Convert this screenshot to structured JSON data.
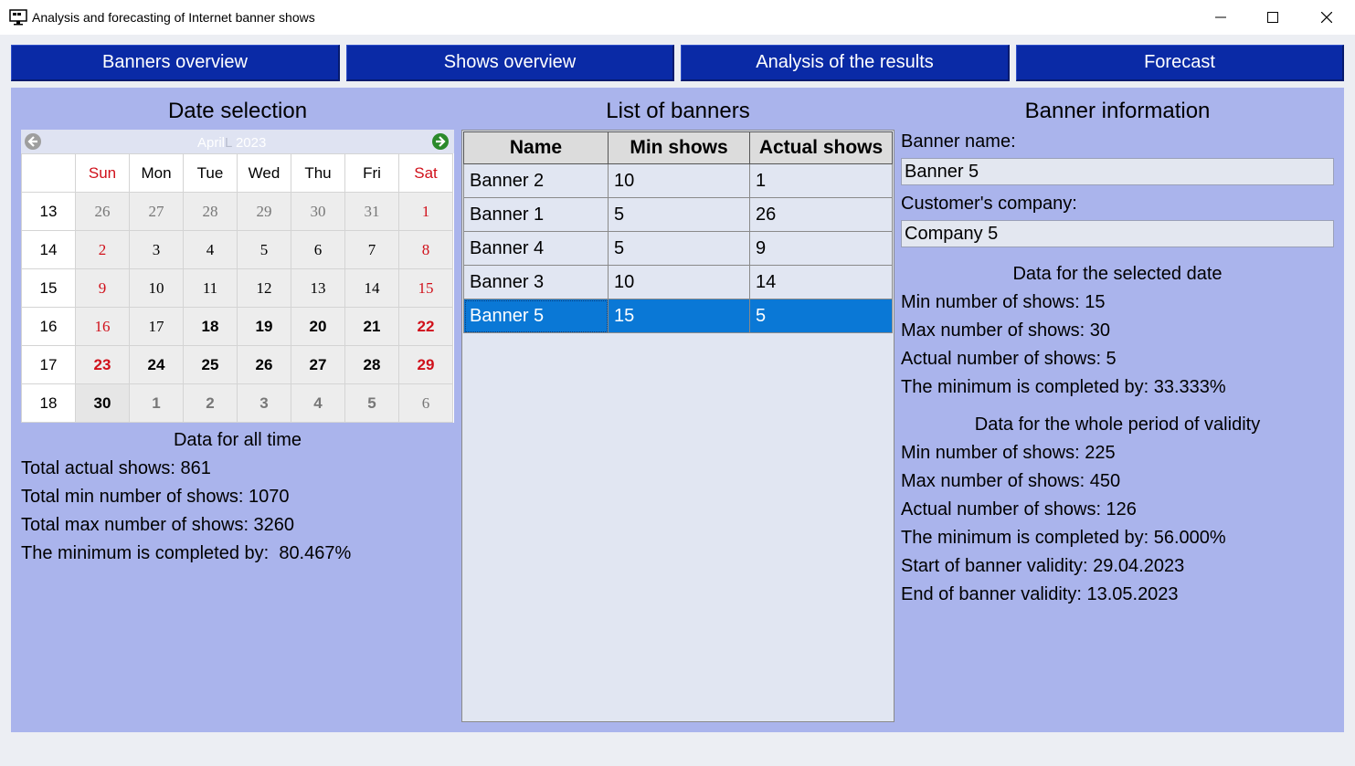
{
  "window": {
    "title": "Analysis and forecasting of Internet banner shows"
  },
  "tabs": [
    {
      "label": "Banners overview"
    },
    {
      "label": "Shows overview"
    },
    {
      "label": "Analysis of the results"
    },
    {
      "label": "Forecast"
    }
  ],
  "date_selection": {
    "title": "Date selection",
    "calendar": {
      "month": "April",
      "year": "2023",
      "day_names": [
        "Sun",
        "Mon",
        "Tue",
        "Wed",
        "Thu",
        "Fri",
        "Sat"
      ],
      "weeks": [
        {
          "week": "13",
          "days": [
            "26",
            "27",
            "28",
            "29",
            "30",
            "31",
            "1"
          ]
        },
        {
          "week": "14",
          "days": [
            "2",
            "3",
            "4",
            "5",
            "6",
            "7",
            "8"
          ]
        },
        {
          "week": "15",
          "days": [
            "9",
            "10",
            "11",
            "12",
            "13",
            "14",
            "15"
          ]
        },
        {
          "week": "16",
          "days": [
            "16",
            "17",
            "18",
            "19",
            "20",
            "21",
            "22"
          ]
        },
        {
          "week": "17",
          "days": [
            "23",
            "24",
            "25",
            "26",
            "27",
            "28",
            "29"
          ]
        },
        {
          "week": "18",
          "days": [
            "30",
            "1",
            "2",
            "3",
            "4",
            "5",
            "6"
          ]
        }
      ],
      "selected_day": "30"
    },
    "all_time": {
      "title": "Data for all time",
      "total_actual": "Total actual shows: 861",
      "total_min": "Total min number of shows: 1070",
      "total_max": "Total max number of shows: 3260",
      "completed": "The minimum is completed by:  80.467%"
    }
  },
  "banner_list": {
    "title": "List of banners",
    "columns": [
      "Name",
      "Min shows",
      "Actual shows"
    ],
    "rows": [
      {
        "name": "Banner 2",
        "min": "10",
        "actual": "1"
      },
      {
        "name": "Banner 1",
        "min": "5",
        "actual": "26"
      },
      {
        "name": "Banner 4",
        "min": "5",
        "actual": "9"
      },
      {
        "name": "Banner 3",
        "min": "10",
        "actual": "14"
      },
      {
        "name": "Banner 5",
        "min": "15",
        "actual": "5"
      }
    ],
    "selected_row": 4
  },
  "banner_info": {
    "title": "Banner information",
    "name_label": "Banner name:",
    "name_value": "Banner 5",
    "company_label": "Customer's company:",
    "company_value": "Company 5",
    "selected_date": {
      "title": "Data for the selected date",
      "min": "Min number of shows: 15",
      "max": "Max number of shows: 30",
      "actual": "Actual number of shows: 5",
      "completed": "The minimum is completed by: 33.333%"
    },
    "whole_period": {
      "title": "Data for the whole period of validity",
      "min": "Min number of shows: 225",
      "max": "Max number of shows: 450",
      "actual": "Actual number of shows: 126",
      "completed": "The minimum is completed by: 56.000%",
      "start": "Start of banner validity: 29.04.2023",
      "end": "End of banner validity: 13.05.2023"
    }
  },
  "colors": {
    "tab_bg": "#0a2aa6",
    "panel_bg": "#aab4ec",
    "selection": "#0a78d6",
    "weekend": "#d0101a"
  }
}
